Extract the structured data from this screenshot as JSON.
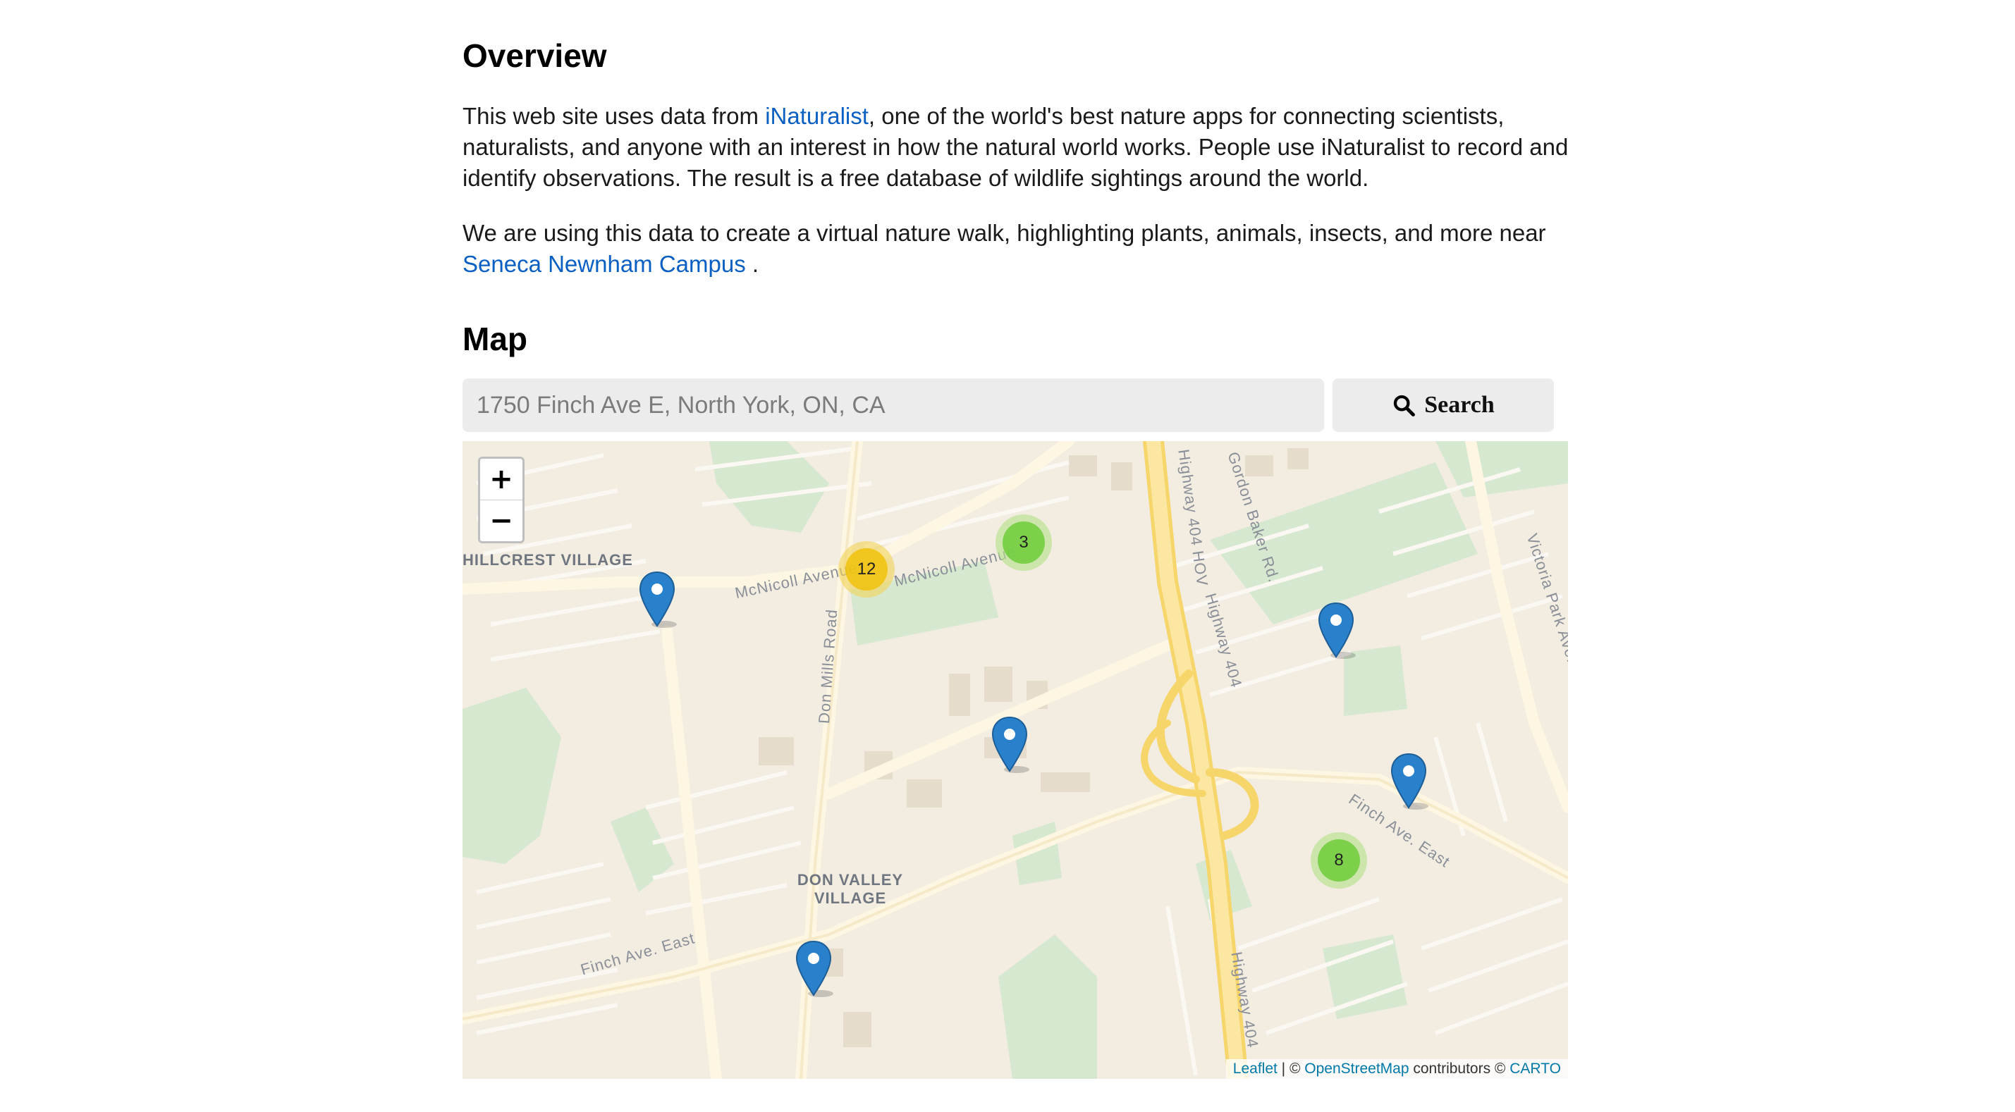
{
  "overview": {
    "heading": "Overview",
    "p1_before": "This web site uses data from ",
    "p1_link": "iNaturalist",
    "p1_after": ", one of the world's best nature apps for connecting scientists, naturalists, and anyone with an interest in how the natural world works. People use iNaturalist to record and identify observations. The result is a free database of wildlife sightings around the world.",
    "p2_before": "We are using this data to create a virtual nature walk, highlighting plants, animals, insects, and more near ",
    "p2_link": "Seneca Newnham Campus",
    "p2_after": " ."
  },
  "map_section": {
    "heading": "Map",
    "search_placeholder": "1750 Finch Ave E, North York, ON, CA",
    "search_button": "Search",
    "zoom_in": "+",
    "zoom_out": "−",
    "clusters": [
      "12",
      "3",
      "8"
    ],
    "labels": {
      "hillcrest": "HILLCREST VILLAGE",
      "don_valley": "DON VALLEY VILLAGE",
      "mcnicoll_1": "McNicoll Avenue",
      "mcnicoll_2": "McNicoll Avenue",
      "don_mills": "Don Mills Road",
      "hwy404hov": "Highway 404 HOV",
      "gordon_baker": "Gordon Baker Rd.",
      "hwy404a": "Highway 404",
      "hwy404b": "Highway 404",
      "victoria_park": "Victoria Park Ave.",
      "finch_east_1": "Finch Ave. East",
      "finch_east_2": "Finch Ave. East"
    },
    "attribution": {
      "leaflet": "Leaflet",
      "sep": " | © ",
      "osm": "OpenStreetMap",
      "contributors": " contributors © ",
      "carto": "CARTO"
    }
  }
}
